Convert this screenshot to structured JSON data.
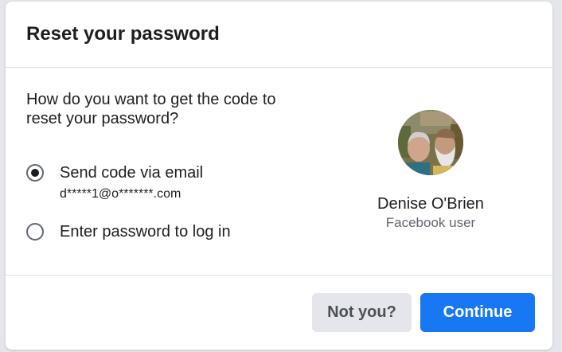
{
  "dialog": {
    "title": "Reset your password"
  },
  "content": {
    "question": "How do you want to get the code to reset your password?",
    "options": [
      {
        "label": "Send code via email",
        "detail": "d*****1@o*******.com",
        "selected": true
      },
      {
        "label": "Enter password to log in",
        "selected": false
      }
    ]
  },
  "profile": {
    "name": "Denise O'Brien",
    "subtitle": "Facebook user"
  },
  "footer": {
    "not_you_label": "Not you?",
    "continue_label": "Continue"
  },
  "colors": {
    "primary": "#1877f2",
    "secondary_button": "#e4e6eb",
    "text": "#1c1e21",
    "muted_text": "#606770"
  }
}
